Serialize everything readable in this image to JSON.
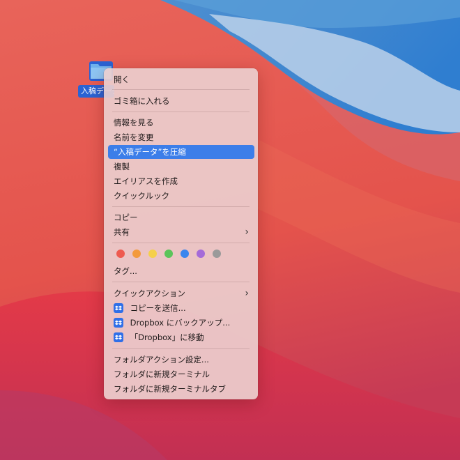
{
  "desktop": {
    "folder_name": "入稿データ"
  },
  "context_menu": {
    "open": "開く",
    "move_to_trash": "ゴミ箱に入れる",
    "get_info": "情報を見る",
    "rename": "名前を変更",
    "compress": "“入稿データ”を圧縮",
    "duplicate": "複製",
    "make_alias": "エイリアスを作成",
    "quick_look": "クイックルック",
    "copy": "コピー",
    "share": "共有",
    "tags": "タグ...",
    "quick_actions": "クイックアクション",
    "dropbox_send_copy": "コピーを送信...",
    "dropbox_backup": "Dropbox にバックアップ...",
    "dropbox_move": "「Dropbox」に移動",
    "folder_action_setup": "フォルダアクション設定...",
    "new_terminal_at_folder": "フォルダに新規ターミナル",
    "new_terminal_tab_at_folder": "フォルダに新規ターミナルタブ",
    "tag_colors": [
      "#ee5a4f",
      "#f39a3c",
      "#f5d04a",
      "#5bc45a",
      "#3a86ee",
      "#a56bd8",
      "#9a9a9a"
    ]
  },
  "icons": {
    "folder": "folder-icon",
    "submenu": "chevron-right-icon",
    "dropbox": "dropbox-icon"
  }
}
